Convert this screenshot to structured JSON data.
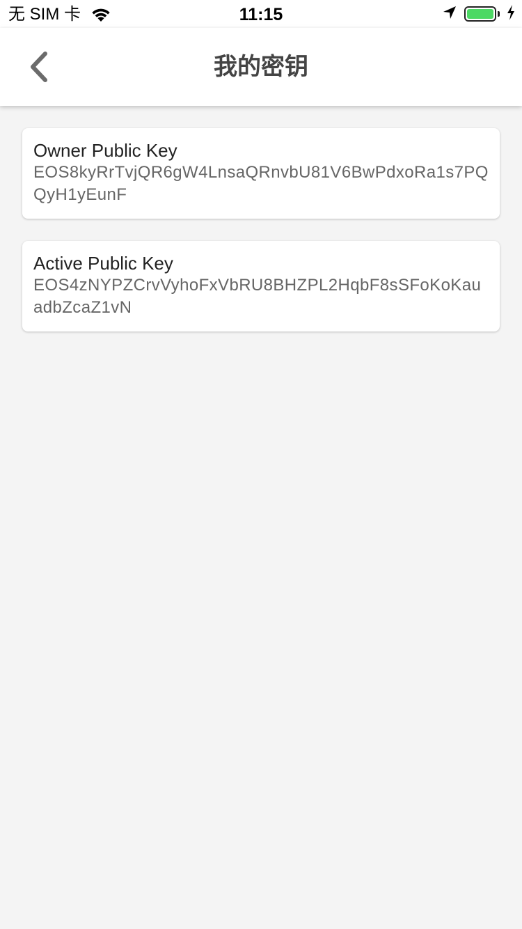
{
  "status_bar": {
    "carrier": "无 SIM 卡",
    "time": "11:15",
    "battery_level": 1.0,
    "battery_color": "#4cd964"
  },
  "nav": {
    "title": "我的密钥",
    "back_icon": "chevron-left-icon"
  },
  "keys": [
    {
      "label": "Owner Public Key",
      "value": "EOS8kyRrTvjQR6gW4LnsaQRnvbU81V6BwPdxoRa1s7PQQyH1yEunF"
    },
    {
      "label": "Active Public Key",
      "value": "EOS4zNYPZCrvVyhoFxVbRU8BHZPL2HqbF8sSFoKoKauadbZcaZ1vN"
    }
  ]
}
